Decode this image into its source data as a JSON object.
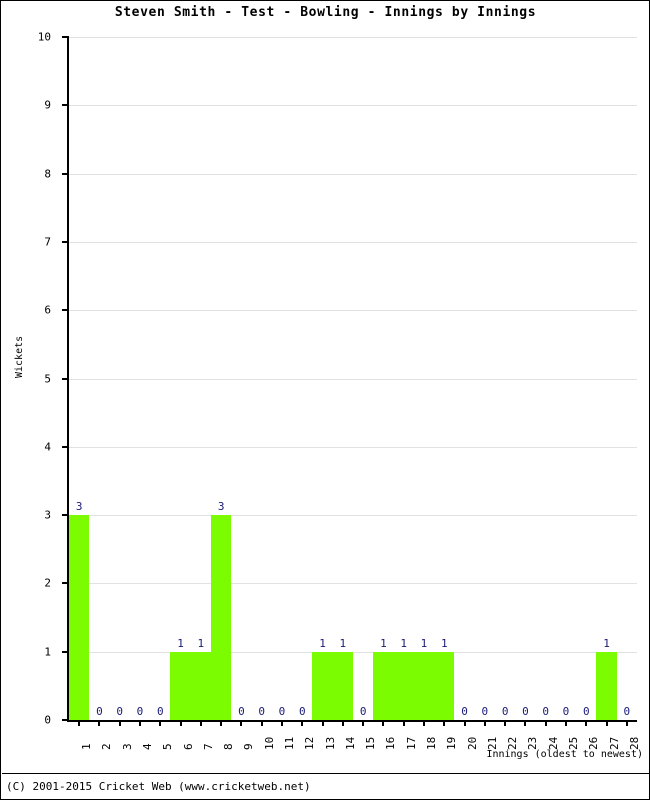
{
  "title": "Steven Smith - Test - Bowling - Innings by Innings",
  "footer": "(C) 2001-2015 Cricket Web (www.cricketweb.net)",
  "axes": {
    "y_title": "Wickets",
    "x_title": "Innings (oldest to newest)"
  },
  "colors": {
    "bar": "#7cfc00",
    "bar_label": "#19197a",
    "grid": "#e2e2e2",
    "axis": "#000000",
    "background": "#ffffff"
  },
  "chart_data": {
    "type": "bar",
    "title": "Steven Smith - Test - Bowling - Innings by Innings",
    "xlabel": "Innings (oldest to newest)",
    "ylabel": "Wickets",
    "ylim": [
      0,
      10
    ],
    "yticks": [
      0,
      1,
      2,
      3,
      4,
      5,
      6,
      7,
      8,
      9,
      10
    ],
    "grid": true,
    "legend": "none",
    "bar_gap": 0,
    "data_labels": true,
    "categories": [
      "1",
      "2",
      "3",
      "4",
      "5",
      "6",
      "7",
      "8",
      "9",
      "10",
      "11",
      "12",
      "13",
      "14",
      "15",
      "16",
      "17",
      "18",
      "19",
      "20",
      "21",
      "22",
      "23",
      "24",
      "25",
      "26",
      "27",
      "28"
    ],
    "values": [
      3,
      0,
      0,
      0,
      0,
      1,
      1,
      3,
      0,
      0,
      0,
      0,
      1,
      1,
      0,
      1,
      1,
      1,
      1,
      0,
      0,
      0,
      0,
      0,
      0,
      0,
      1,
      0
    ],
    "series": [
      {
        "name": "Wickets",
        "color": "#7cfc00",
        "values": [
          3,
          0,
          0,
          0,
          0,
          1,
          1,
          3,
          0,
          0,
          0,
          0,
          1,
          1,
          0,
          1,
          1,
          1,
          1,
          0,
          0,
          0,
          0,
          0,
          0,
          0,
          1,
          0
        ]
      }
    ]
  }
}
